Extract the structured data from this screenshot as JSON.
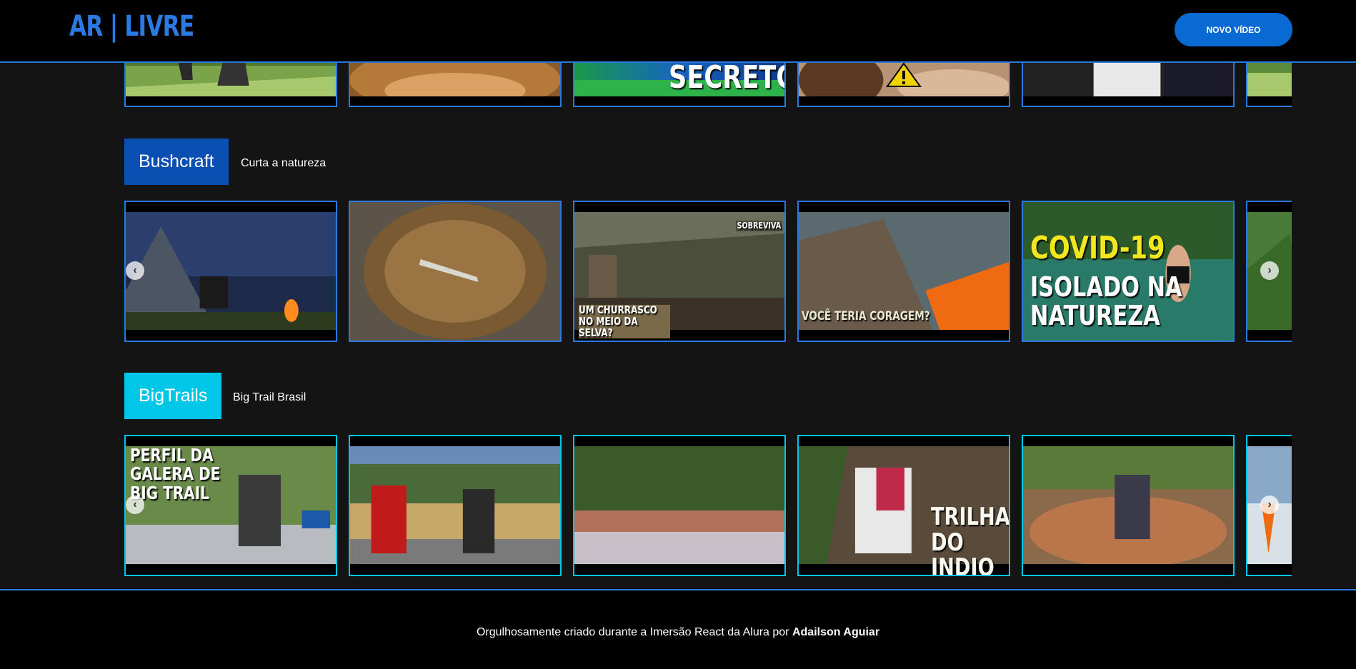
{
  "header": {
    "logo": "AR | LIVRE",
    "new_video_label": "NOVO VÍDEO"
  },
  "top_row": {
    "captions": [
      "",
      "",
      "SECRETO",
      "",
      "",
      ""
    ]
  },
  "categories": [
    {
      "title": "Bushcraft",
      "description": "Curta a natureza",
      "color": "#0a4fb2",
      "cards": [
        {
          "caption": "",
          "icon": "camp-tent-thumbnail"
        },
        {
          "caption": "",
          "icon": "basket-knife-thumbnail"
        },
        {
          "caption": "UM CHURRASCO NO MEIO DA SELVA?",
          "tag": "SOBREVIVA"
        },
        {
          "caption": "VOCÊ TERIA CORAGEM?",
          "tag": ""
        },
        {
          "caption": "COVID-19",
          "caption2": "ISOLADO NA NATUREZA"
        },
        {
          "caption": ""
        }
      ]
    },
    {
      "title": "BigTrails",
      "description": "Big Trail Brasil",
      "color": "#00c6e8",
      "cards": [
        {
          "caption": "PERFIL DA GALERA DE BIG TRAIL"
        },
        {
          "caption": ""
        },
        {
          "caption": ""
        },
        {
          "caption": "TRILHA DO INDIO !!!"
        },
        {
          "caption": ""
        },
        {
          "caption": ""
        }
      ]
    }
  ],
  "footer": {
    "text": "Orgulhosamente criado durante a Imersão React da Alura por ",
    "author": "Adailson Aguiar"
  },
  "colors": {
    "accent": "#2a7ae2",
    "button": "#0a6ad4",
    "bushcraft": "#0a4fb2",
    "bigtrails": "#00c6e8"
  }
}
